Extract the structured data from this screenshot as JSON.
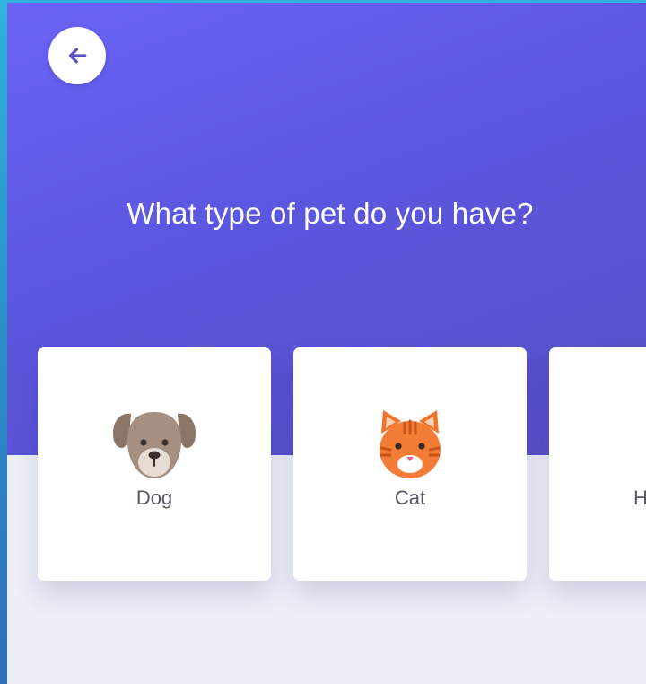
{
  "header": {
    "back_icon": "arrow-left-icon",
    "title": "What type of pet do you have?"
  },
  "pets": [
    {
      "label": "Dog",
      "icon": "dog-icon"
    },
    {
      "label": "Cat",
      "icon": "cat-icon"
    },
    {
      "label": "H"
    }
  ],
  "colors": {
    "header_gradient_start": "#6a63f6",
    "header_gradient_end": "#5a4fc6",
    "page_background": "#eef0f8",
    "card_background": "#ffffff",
    "label_text": "#555a66",
    "title_text": "#ffffff"
  }
}
